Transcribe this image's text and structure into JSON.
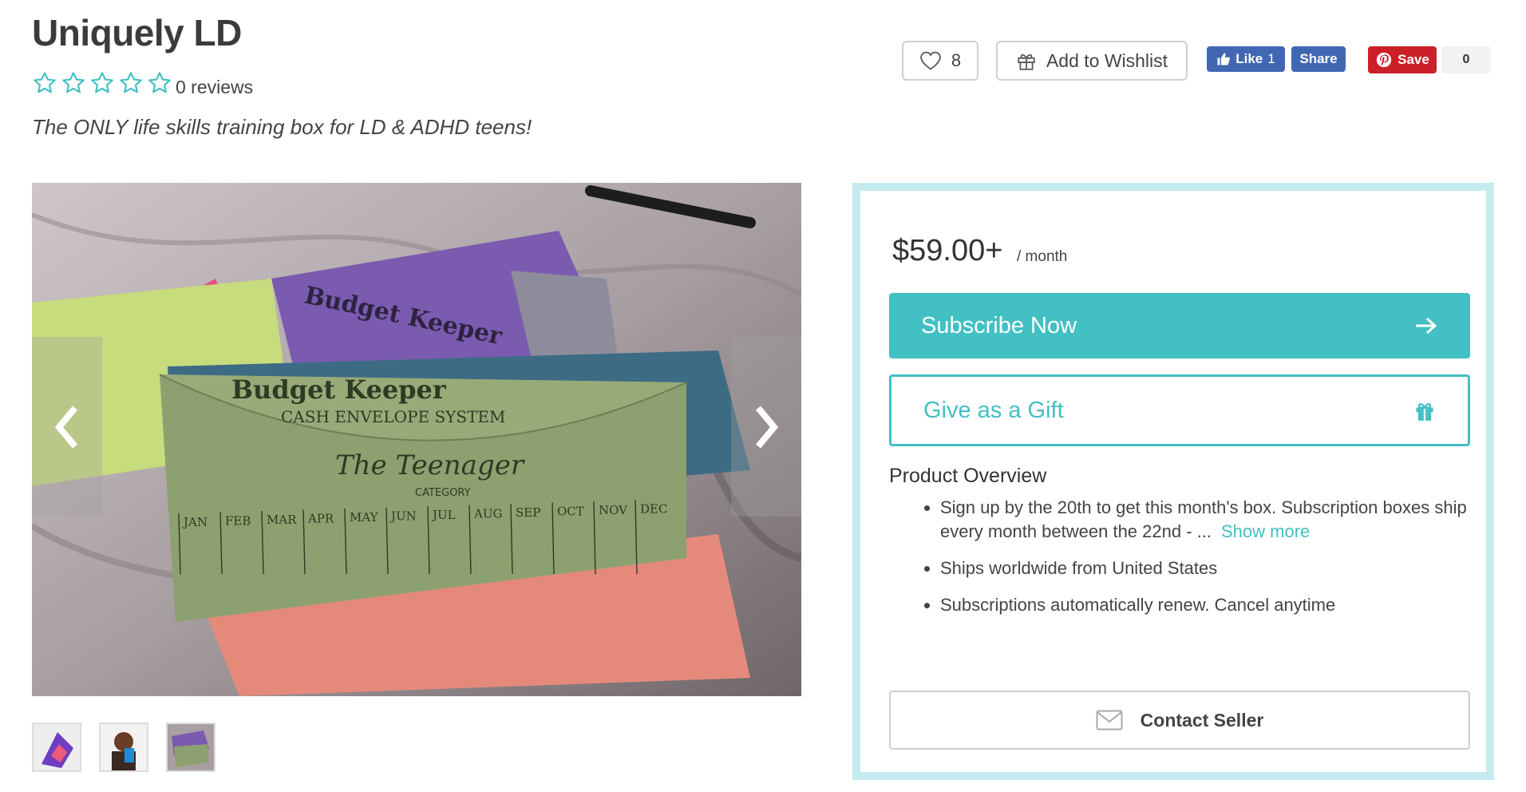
{
  "header": {
    "store_name": "Uniquely LD",
    "rating_stars": 0,
    "reviews_text": "0 reviews",
    "tagline": "The ONLY life skills training box for LD & ADHD teens!"
  },
  "actions": {
    "favorite_count": "8",
    "wishlist_label": "Add to Wishlist",
    "fb_like_label": "Like",
    "fb_like_count": "1",
    "fb_share_label": "Share",
    "pin_save_label": "Save",
    "pin_count": "0"
  },
  "gallery": {
    "envelope_brand": "Budget Keeper",
    "envelope_subtitle": "CASH ENVELOPE SYSTEM",
    "envelope_category": "The Teenager",
    "category_word": "CATEGORY",
    "months": [
      "JAN",
      "FEB",
      "MAR",
      "APR",
      "MAY",
      "JUN",
      "JUL",
      "AUG",
      "SEP",
      "OCT",
      "NOV",
      "DEC"
    ],
    "thumbnails": [
      "thumb-1",
      "thumb-2",
      "thumb-3"
    ]
  },
  "purchase": {
    "price": "$59.00+",
    "period": "/ month",
    "subscribe_label": "Subscribe Now",
    "gift_label": "Give as a Gift",
    "overview_title": "Product Overview",
    "bullets": [
      "Sign up by the 20th to get this month's box. Subscription boxes ship every month between the 22nd - ...",
      "Ships worldwide from United States",
      "Subscriptions automatically renew. Cancel anytime"
    ],
    "show_more": "Show more",
    "contact_label": "Contact Seller"
  },
  "colors": {
    "teal": "#42c0c3",
    "panel_border": "#c4ecee",
    "facebook": "#4267b2",
    "pinterest": "#cb2027"
  }
}
